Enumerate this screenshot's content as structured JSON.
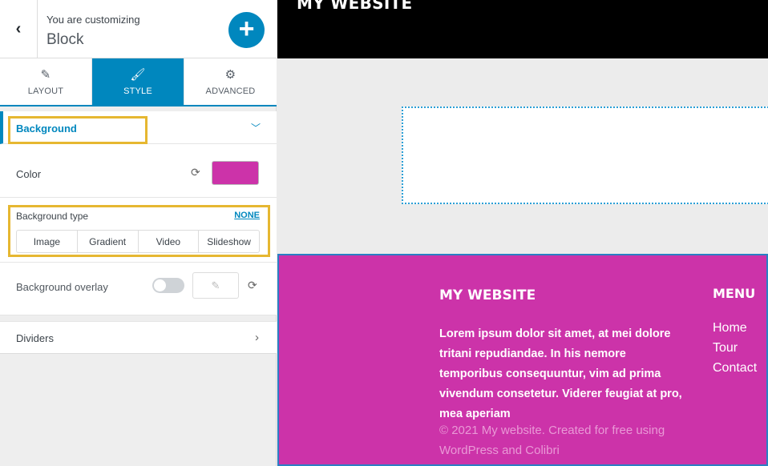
{
  "header": {
    "back_icon": "chevron-left-icon",
    "customizing_label": "You are customizing",
    "customizing_title": "Block",
    "add_icon": "plus-icon"
  },
  "tabs": [
    {
      "label": "LAYOUT",
      "icon": "pencil-icon",
      "active": false
    },
    {
      "label": "STYLE",
      "icon": "brush-icon",
      "active": true
    },
    {
      "label": "ADVANCED",
      "icon": "gears-icon",
      "active": false
    }
  ],
  "background_section": {
    "title": "Background",
    "color_label": "Color",
    "color_value": "#cc33a9",
    "type_label": "Background type",
    "type_none": "NONE",
    "type_options": [
      "Image",
      "Gradient",
      "Video",
      "Slideshow"
    ],
    "overlay_label": "Background overlay"
  },
  "dividers": {
    "label": "Dividers"
  },
  "preview": {
    "site_title": "MY WEBSITE",
    "footer": {
      "title": "MY WEBSITE",
      "text": "Lorem ipsum dolor sit amet, at mei dolore tritani repudiandae. In his nemore temporibus consequuntur, vim ad prima vivendum consetetur. Viderer feugiat at pro, mea aperiam",
      "copyright": "© 2021 My website. Created for free using WordPress and Colibri",
      "menu_title": "MENU",
      "menu_items": [
        "Home",
        "Tour",
        "Contact"
      ]
    }
  },
  "colors": {
    "accent": "#0087be",
    "highlight": "#e6b731",
    "footer_bg": "#cc33a9"
  }
}
